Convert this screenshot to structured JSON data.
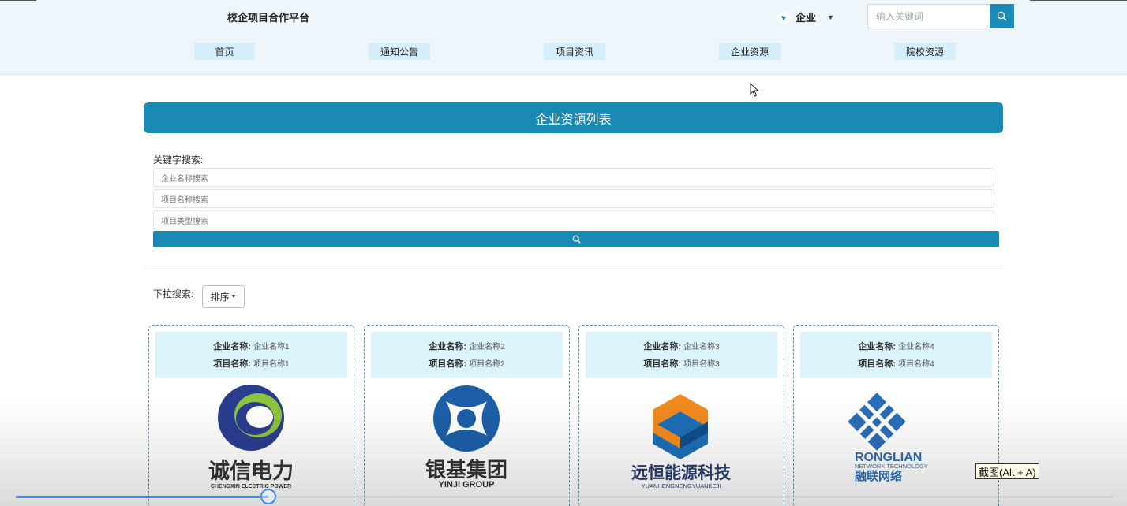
{
  "header": {
    "site_title": "校企项目合作平台",
    "user_label": "企业",
    "search_placeholder": "输入关键词"
  },
  "nav": {
    "items": [
      {
        "label": "首页"
      },
      {
        "label": "通知公告"
      },
      {
        "label": "项目资讯"
      },
      {
        "label": "企业资源"
      },
      {
        "label": "院校资源"
      }
    ]
  },
  "main": {
    "banner_title": "企业资源列表",
    "keyword_label": "关键字搜索:",
    "company_placeholder": "企业名称搜索",
    "project_placeholder": "项目名称搜索",
    "type_placeholder": "项目类型搜索",
    "dropdown_label": "下拉搜索:",
    "sort_label": "排序"
  },
  "cards": [
    {
      "company_key": "企业名称:",
      "company": "企业名称1",
      "project_key": "项目名称:",
      "project": "项目名称1",
      "logo_text": "诚信电力",
      "logo_sub": "CHENGXIN ELECTRIC POWER"
    },
    {
      "company_key": "企业名称:",
      "company": "企业名称2",
      "project_key": "项目名称:",
      "project": "项目名称2",
      "logo_text": "银基集团",
      "logo_sub": "YINJI GROUP"
    },
    {
      "company_key": "企业名称:",
      "company": "企业名称3",
      "project_key": "项目名称:",
      "project": "项目名称3",
      "logo_text": "远恒能源科技",
      "logo_sub": "YUANHENGNENGYUANKEJI"
    },
    {
      "company_key": "企业名称:",
      "company": "企业名称4",
      "project_key": "项目名称:",
      "project": "项目名称4",
      "logo_text": "融联网络",
      "logo_sub": "RONGLIAN",
      "logo_sub2": "NETWORK TECHNOLOGY"
    }
  ],
  "overlay": {
    "tooltip": "截图(Alt + A)",
    "progress": 0.23
  },
  "colors": {
    "primary": "#1a8ab5",
    "header_bg": "#eef6fc",
    "nav_item_bg": "#d5eefb",
    "card_info_bg": "#dbf3fa",
    "progress": "#3d8ee6"
  }
}
